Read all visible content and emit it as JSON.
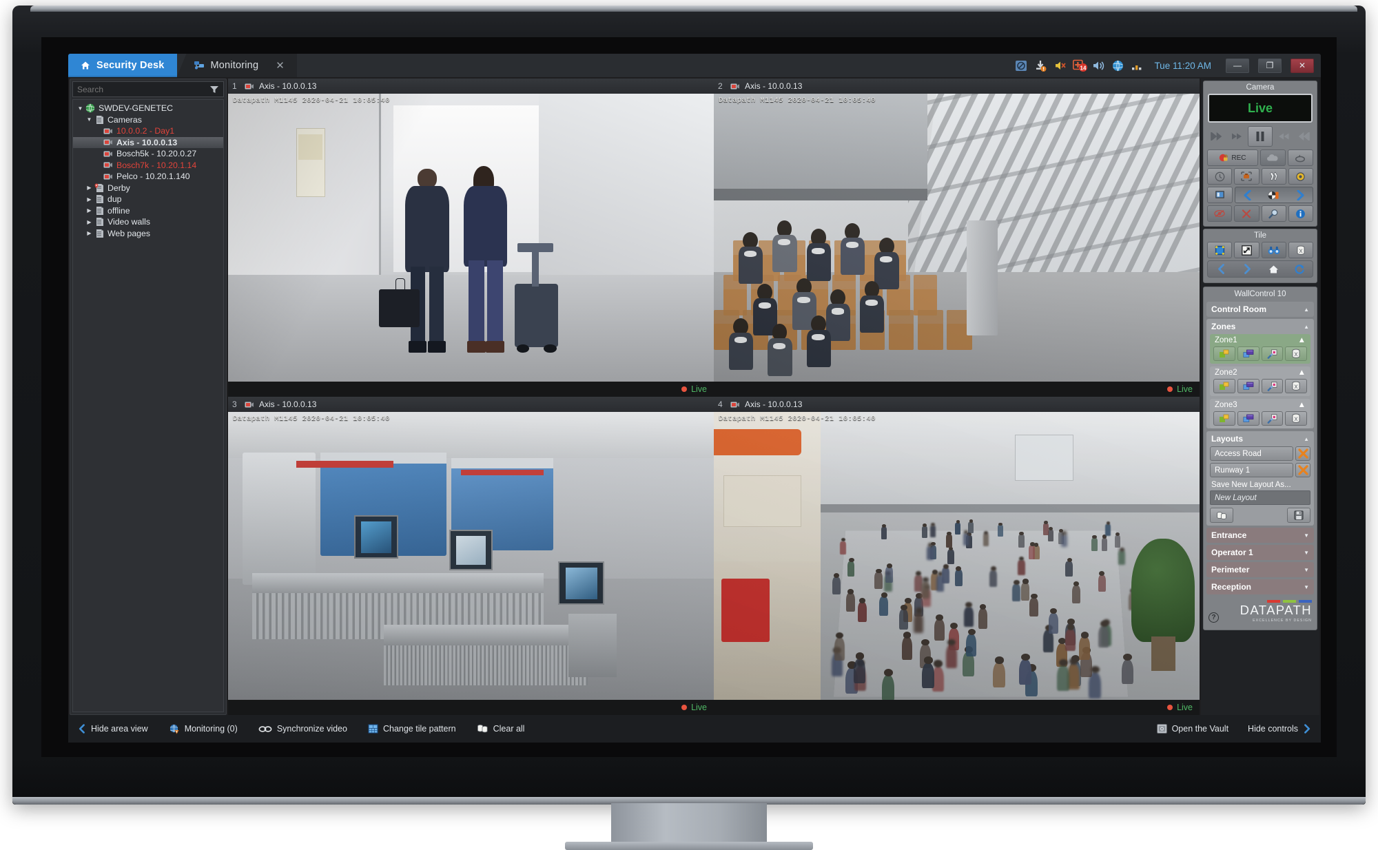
{
  "window": {
    "tabs": [
      {
        "label": "Security Desk",
        "icon": "home-icon",
        "active": true
      },
      {
        "label": "Monitoring",
        "icon": "monitoring-icon",
        "active": false,
        "closable": true
      }
    ],
    "tray": {
      "icons": [
        "no-entry-icon",
        "download-alert-icon",
        "mute-speaker-icon",
        "alarm-badge-icon",
        "speaker-icon",
        "globe-icon",
        "bar-chart-icon"
      ],
      "alarm_count": "14",
      "clock": "Tue 11:20 AM"
    },
    "controls": {
      "minimize": "—",
      "restore": "❐",
      "close": "✕"
    }
  },
  "sidebar": {
    "search": {
      "placeholder": "Search",
      "value": ""
    },
    "filter_icon": "filter-icon",
    "tree": [
      {
        "label": "SWDEV-GENETEC",
        "depth": 0,
        "icon": "globe-icon",
        "expanded": true,
        "state": "normal"
      },
      {
        "label": "Cameras",
        "depth": 1,
        "icon": "server-icon",
        "expanded": true,
        "state": "normal"
      },
      {
        "label": "10.0.0.2 - Day1",
        "depth": 2,
        "icon": "camera-icon",
        "state": "alarm"
      },
      {
        "label": "Axis - 10.0.0.13",
        "depth": 2,
        "icon": "camera-icon",
        "state": "selected"
      },
      {
        "label": "Bosch5k - 10.20.0.27",
        "depth": 2,
        "icon": "camera-icon",
        "state": "normal"
      },
      {
        "label": "Bosch7k - 10.20.1.14",
        "depth": 2,
        "icon": "camera-icon",
        "state": "alarm"
      },
      {
        "label": "Pelco - 10.20.1.140",
        "depth": 2,
        "icon": "camera-icon",
        "state": "normal"
      },
      {
        "label": "Derby",
        "depth": 1,
        "icon": "server-pin-icon",
        "expanded": false,
        "state": "normal"
      },
      {
        "label": "dup",
        "depth": 1,
        "icon": "server-icon",
        "expanded": false,
        "state": "normal"
      },
      {
        "label": "offline",
        "depth": 1,
        "icon": "server-icon",
        "expanded": false,
        "state": "normal"
      },
      {
        "label": "Video walls",
        "depth": 1,
        "icon": "server-icon",
        "expanded": false,
        "state": "normal"
      },
      {
        "label": "Web pages",
        "depth": 1,
        "icon": "server-icon",
        "expanded": false,
        "state": "normal"
      }
    ]
  },
  "video": {
    "tiles": [
      {
        "number": "1",
        "title": "Axis - 10.0.0.13",
        "osd": "Datapath M1145 2020-04-21 10:05:40",
        "status": "Live",
        "selected": true,
        "scene": "concourse-walkers"
      },
      {
        "number": "2",
        "title": "Axis - 10.0.0.13",
        "osd": "Datapath M1145 2020-04-21 10:05:40",
        "status": "Live",
        "selected": false,
        "scene": "departure-lounge"
      },
      {
        "number": "3",
        "title": "Axis - 10.0.0.13",
        "osd": "Datapath M1145 2020-04-21 10:05:40",
        "status": "Live",
        "selected": false,
        "scene": "security-screening"
      },
      {
        "number": "4",
        "title": "Axis - 10.0.0.13",
        "osd": "Datapath M1145 2020-04-21 10:05:40",
        "status": "Live",
        "selected": false,
        "scene": "atrium-crowd"
      }
    ]
  },
  "right_panel": {
    "camera": {
      "title": "Camera",
      "lcd_value": "Live",
      "transport": [
        "skip-back-icon",
        "rewind-icon",
        "pause-icon",
        "fast-forward-icon",
        "skip-forward-icon"
      ],
      "buttons": [
        {
          "name": "record-button",
          "label": "REC",
          "icon": "record-lock-icon"
        },
        {
          "name": "cloud-button",
          "label": "",
          "icon": "cloud-icon"
        },
        {
          "name": "snapshot-cycle-button",
          "label": "",
          "icon": "loop-icon"
        },
        {
          "name": "timeline-button",
          "label": "",
          "icon": "clock-icon"
        },
        {
          "name": "bookmark-button",
          "label": "",
          "icon": "briefcase-frame-icon"
        },
        {
          "name": "motion-button",
          "label": "",
          "icon": "running-icon"
        },
        {
          "name": "ptz-button",
          "label": "",
          "icon": "donut-icon"
        },
        {
          "name": "display-button",
          "label": "",
          "icon": "screen-icon"
        },
        {
          "name": "prev-camera-button",
          "label": "",
          "icon": "chevron-left-icon"
        },
        {
          "name": "camera-sequence-button",
          "label": "",
          "icon": "camera-seq-icon"
        },
        {
          "name": "next-camera-button",
          "label": "",
          "icon": "chevron-right-icon"
        },
        {
          "name": "privacy-button",
          "label": "",
          "icon": "privacy-off-icon"
        },
        {
          "name": "delete-button",
          "label": "",
          "icon": "red-x-icon"
        },
        {
          "name": "zoom-button",
          "label": "",
          "icon": "magnifier-icon"
        },
        {
          "name": "info-button",
          "label": "",
          "icon": "info-icon"
        }
      ]
    },
    "tile": {
      "title": "Tile",
      "buttons": [
        {
          "name": "tile-pattern-button",
          "icon": "tile-pattern-icon"
        },
        {
          "name": "maximize-tile-button",
          "icon": "maximize-tile-icon"
        },
        {
          "name": "investigate-button",
          "icon": "binoculars-icon"
        },
        {
          "name": "clear-tile-button",
          "icon": "trash-icon"
        }
      ],
      "nav": [
        {
          "name": "tile-back-button",
          "icon": "chevron-left-icon"
        },
        {
          "name": "tile-forward-button",
          "icon": "chevron-right-icon"
        },
        {
          "name": "tile-home-button",
          "icon": "home-icon"
        },
        {
          "name": "tile-refresh-button",
          "icon": "refresh-icon"
        }
      ]
    },
    "wallcontrol": {
      "title": "WallControl 10",
      "root": {
        "label": "Control Room",
        "caret": "up"
      },
      "zones_section": {
        "label": "Zones",
        "caret": "up"
      },
      "zones": [
        {
          "label": "Zone1",
          "caret": "up",
          "active": true,
          "buttons": [
            "open-window-icon",
            "window-group-icon",
            "pin-source-icon",
            "clear-zone-icon"
          ]
        },
        {
          "label": "Zone2",
          "caret": "up",
          "active": false,
          "buttons": [
            "open-window-icon",
            "window-group-icon",
            "pin-source-icon",
            "clear-zone-icon"
          ]
        },
        {
          "label": "Zone3",
          "caret": "up",
          "active": false,
          "buttons": [
            "open-window-icon",
            "window-group-icon",
            "pin-source-icon",
            "clear-zone-icon"
          ]
        }
      ],
      "layouts_section": {
        "label": "Layouts",
        "caret": "up"
      },
      "layouts": [
        {
          "label": "Access Road",
          "delete_icon": "orange-x-icon"
        },
        {
          "label": "Runway 1",
          "delete_icon": "orange-x-icon"
        }
      ],
      "save_label": "Save New Layout As...",
      "new_layout_placeholder": "New Layout",
      "new_layout_value": "",
      "save_buttons": [
        {
          "name": "copy-layout-button",
          "icon": "copy-icon"
        },
        {
          "name": "save-layout-button",
          "icon": "floppy-icon"
        }
      ],
      "collapsed": [
        {
          "label": "Entrance",
          "caret": "down"
        },
        {
          "label": "Operator 1",
          "caret": "down"
        },
        {
          "label": "Perimeter",
          "caret": "down"
        },
        {
          "label": "Reception",
          "caret": "down"
        }
      ],
      "help_icon": "help-icon",
      "brand": {
        "name": "DATAPATH",
        "tagline": "EXCELLENCE BY DESIGN",
        "bar_colors": [
          "#d93a31",
          "#8fc240",
          "#3a63c0"
        ]
      }
    }
  },
  "bottom_bar": {
    "left": [
      {
        "label": "Hide area view",
        "icon": "chevron-left-icon"
      },
      {
        "label": "Monitoring (0)",
        "icon": "monitoring-alert-icon"
      },
      {
        "label": "Synchronize video",
        "icon": "link-icon"
      },
      {
        "label": "Change tile pattern",
        "icon": "tile-grid-icon"
      },
      {
        "label": "Clear all",
        "icon": "clear-all-icon"
      }
    ],
    "right": [
      {
        "label": "Open the Vault",
        "icon": "vault-icon"
      },
      {
        "label": "Hide controls",
        "icon": "chevron-right-icon"
      }
    ]
  },
  "colors": {
    "accent_blue": "#2f86d4",
    "alarm_red": "#e2443b",
    "live_green": "#4fb765",
    "selection_yellow": "#c9b54a",
    "panel_gray": "#7d8084",
    "zone_active_green": "#8aa886"
  }
}
